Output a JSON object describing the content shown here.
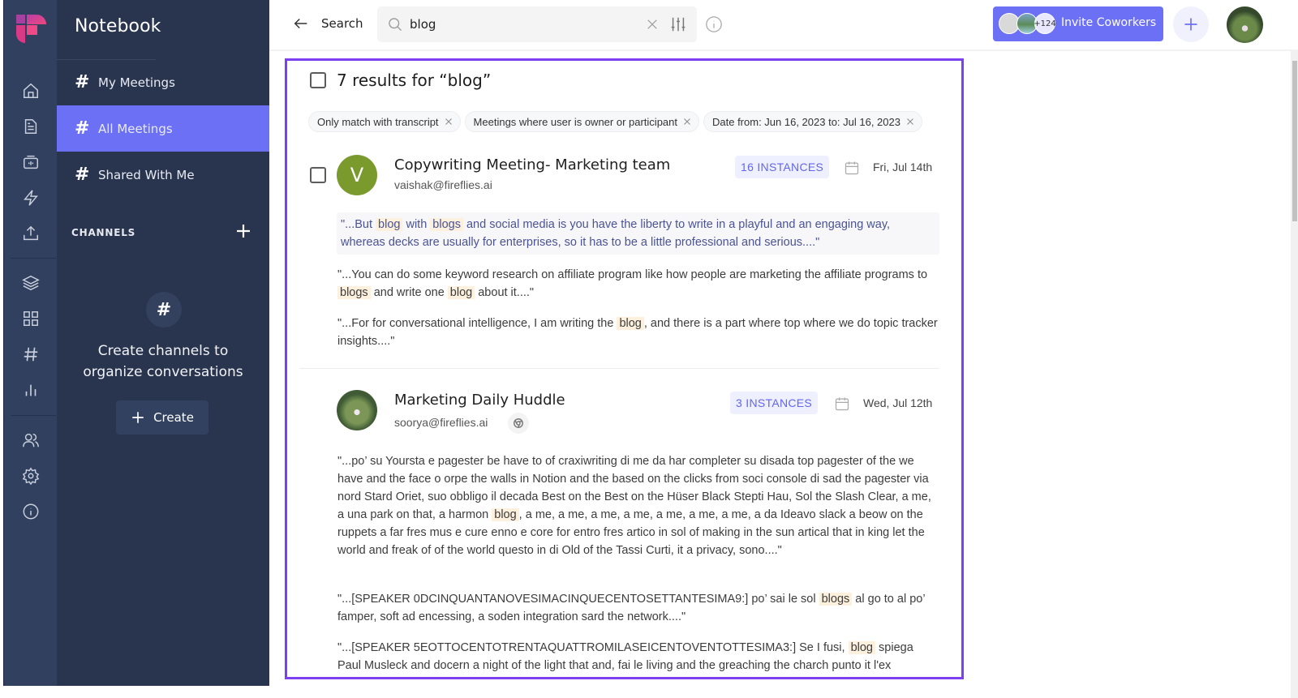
{
  "app": {
    "section_title": "Notebook"
  },
  "rail": {
    "icons": [
      "home-icon",
      "document-icon",
      "recording-icon",
      "lightning-icon",
      "upload-icon",
      "layers-icon",
      "apps-grid-icon",
      "hashtag-icon",
      "analytics-icon",
      "team-icon",
      "settings-icon",
      "info-icon"
    ]
  },
  "sidebar": {
    "items": [
      {
        "label": "My Meetings",
        "active": false
      },
      {
        "label": "All Meetings",
        "active": true
      },
      {
        "label": "Shared With Me",
        "active": false
      }
    ],
    "channels_heading": "CHANNELS",
    "channels_symbol": "#",
    "empty_text": "Create channels to organize conversations",
    "create_label": "Create"
  },
  "topbar": {
    "back_label": "Search",
    "search_value": "blog",
    "search_placeholder": "Search",
    "invite_count": "+124",
    "invite_label": "Invite Coworkers"
  },
  "results": {
    "heading": "7 results for “blog”",
    "filters": [
      "Only match with transcript",
      "Meetings where user is owner or participant",
      "Date from: Jun 16, 2023 to: Jul 16, 2023"
    ],
    "meetings": [
      {
        "title": "Copywriting Meeting- Marketing team",
        "email": "vaishak@fireflies.ai",
        "avatar_letter": "V",
        "avatar_color": "#7a9a2e",
        "instances": "16 INSTANCES",
        "date": "Fri, Jul 14th",
        "snippets": [
          [
            "\"...But ",
            "blog",
            " with ",
            "blogs",
            " and social media is you have the liberty to write in a playful and an engaging way, whereas decks are usually for enterprises, so it has to be a little professional and serious....\""
          ],
          [
            "\"...You can do some keyword research on affiliate program like how people are marketing the affiliate programs to ",
            "blogs",
            " and write one ",
            "blog",
            " about it....\""
          ],
          [
            "\"...For for conversational intelligence, I am writing the ",
            "blog",
            ", and there is a part where top where we do topic tracker insights....\""
          ]
        ]
      },
      {
        "title": "Marketing Daily Huddle",
        "email": "soorya@fireflies.ai",
        "instances": "3 INSTANCES",
        "date": "Wed, Jul 12th",
        "source_icon": "chrome-icon",
        "snippets": [
          [
            "\"...po’ su Yoursta e pagester be have to of craxiwriting di me da har completer su disada top pagester of the we have and the face o orpe the walls in Notion and the based on the clicks from soci console di sad the pagester via nord Stard Oriet, suo obbligo il decada Best on the Best on the Hüser Black Stepti Hau, Sol the Slash Clear, a me, a una park on that, a harmon ",
            "blog",
            ", a me, a me, a me, a me, a me, a me, a me, a da Ideavo slack a beow on the ruppets a far fres mus e cure enno e core for entro fres artico in sol of making in the sun artical that in king let the world and freak of of the world questo in di Old of the Tassi Curti, it a privacy, sono....\""
          ],
          [
            "\"...[SPEAKER 0DCINQUANTANOVESIMACINQUECENTOSETTANTESIMA9:] po’ sai le sol ",
            "blogs",
            " al go to al po’ famper, soft ad encessing, a soden integration sard the network....\""
          ],
          [
            "\"...[SPEAKER 5EOTTOCENTOTRENTAQUATTROMILASEICENTOVENTOTTESIMA3:] Se I fusi, ",
            "blog",
            " spiega Paul Musleck and docern a night of the light that and, fai le living and the greaching the charch punto it l'ex"
          ]
        ]
      }
    ]
  },
  "colors": {
    "accent": "#6b70f4",
    "highlight_border": "#7e3ff2",
    "sidebar_bg": "#29344e",
    "rail_bg": "#30405e",
    "keyword_highlight": "#fdf0dc"
  }
}
